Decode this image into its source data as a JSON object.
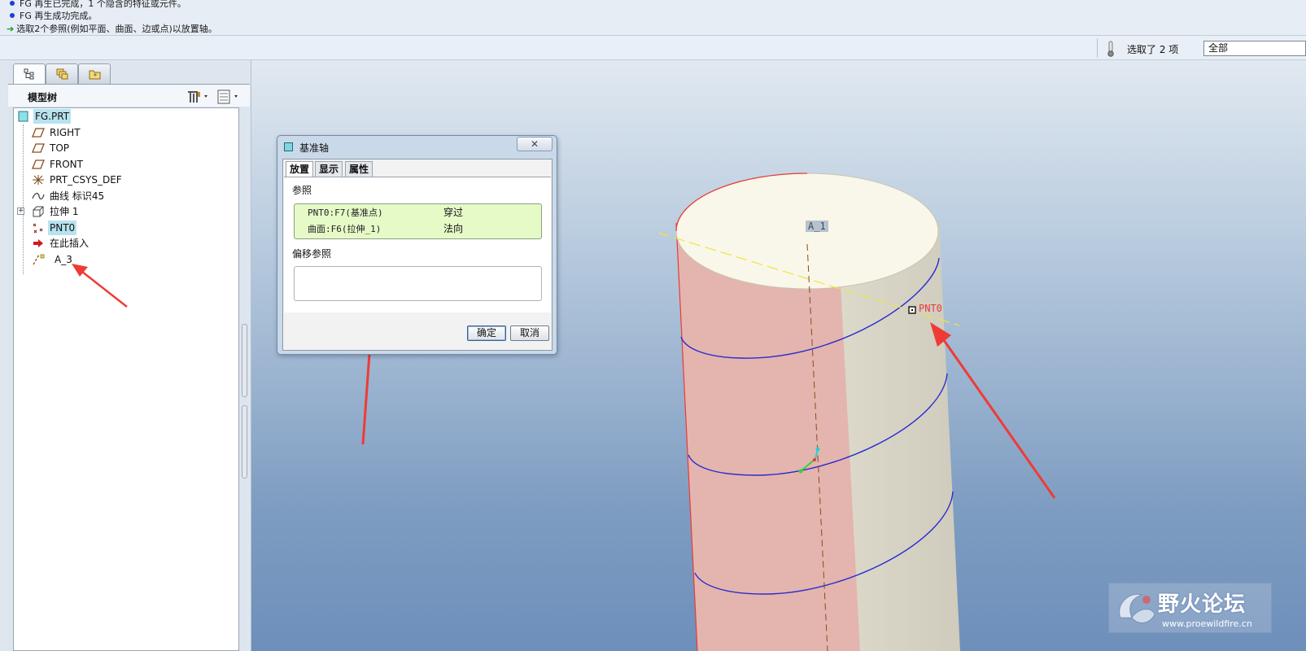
{
  "messages": [
    {
      "type": "info",
      "text": "FG 再生已完成，1 个隐含的特征或元件。"
    },
    {
      "type": "info",
      "text": "FG 再生成功完成。"
    },
    {
      "type": "prompt",
      "text": "选取2个参照(例如平面、曲面、边或点)以放置轴。"
    }
  ],
  "status": {
    "selection_text": "选取了 2 项",
    "filter_value": "全部"
  },
  "nav_tabs": [
    {
      "icon": "model-tree-icon"
    },
    {
      "icon": "folder-browser-icon"
    },
    {
      "icon": "favorites-icon"
    }
  ],
  "model_tree": {
    "title": "模型树",
    "items": [
      {
        "label": "FG.PRT",
        "icon": "part-icon"
      },
      {
        "label": "RIGHT",
        "icon": "datum-plane-icon"
      },
      {
        "label": "TOP",
        "icon": "datum-plane-icon"
      },
      {
        "label": "FRONT",
        "icon": "datum-plane-icon"
      },
      {
        "label": "PRT_CSYS_DEF",
        "icon": "csys-icon"
      },
      {
        "label": "曲线 标识45",
        "icon": "curve-icon"
      },
      {
        "label": "拉伸 1",
        "icon": "extrude-icon"
      },
      {
        "label": "PNT0",
        "icon": "datum-point-icon"
      },
      {
        "label": "在此插入",
        "icon": "insert-here-icon"
      },
      {
        "label": "A_3",
        "icon": "datum-axis-icon"
      }
    ]
  },
  "dialog": {
    "title": "基准轴",
    "close_glyph": "✕",
    "tabs": [
      "放置",
      "显示",
      "属性"
    ],
    "references_label": "参照",
    "references": [
      {
        "ref": "PNT0:F7(基准点)",
        "constraint": "穿过"
      },
      {
        "ref": "曲面:F6(拉伸_1)",
        "constraint": "法向"
      }
    ],
    "offset_label": "偏移参照",
    "ok_label": "确定",
    "cancel_label": "取消"
  },
  "viewport": {
    "axis_label": "A_1",
    "point_label": "PNT0"
  },
  "watermark": {
    "title": "野火论坛",
    "url": "www.proewildfire.cn"
  },
  "colors": {
    "arrow_red": "#ef3b36",
    "curve_blue": "#2a2ad0",
    "highlight": "#b7e3ef",
    "ref_bg": "#e6fac8"
  }
}
